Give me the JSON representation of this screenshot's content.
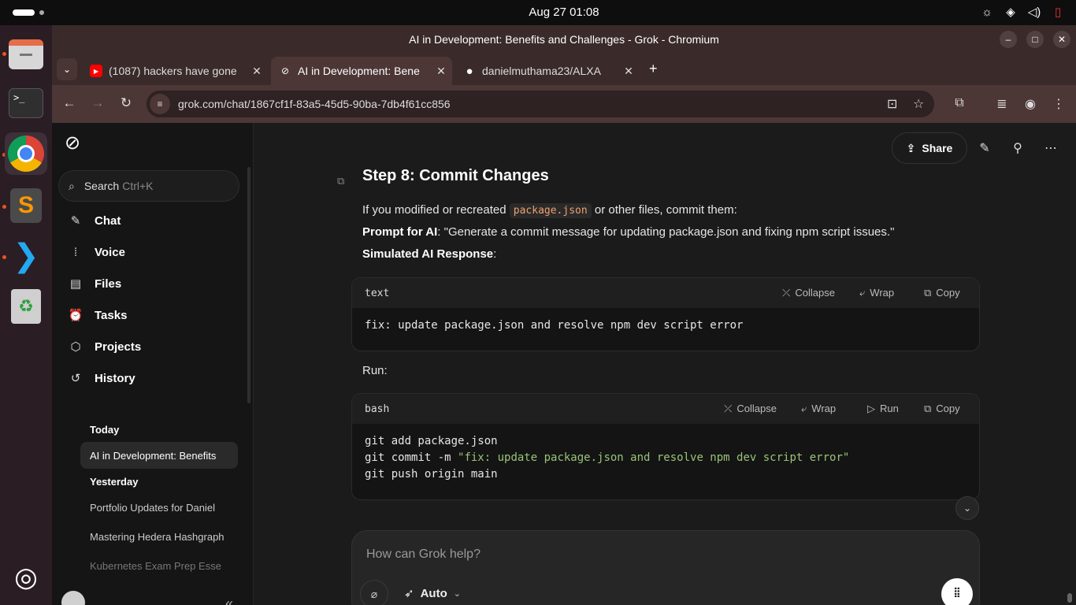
{
  "topbar": {
    "clock": "Aug 27  01:08",
    "tray_icons": [
      "brightness-icon",
      "wifi-icon",
      "volume-icon",
      "battery-icon"
    ]
  },
  "dock": {
    "apps": [
      "files",
      "terminal",
      "chromium",
      "sublime-text",
      "vscode",
      "trash",
      "ubuntu-apps"
    ]
  },
  "window": {
    "title": "AI in Development: Benefits and Challenges - Grok - Chromium"
  },
  "tabs": [
    {
      "label": "(1087) hackers have gone",
      "favicon": "youtube"
    },
    {
      "label": "AI in Development: Bene",
      "favicon": "grok",
      "active": true
    },
    {
      "label": "danielmuthama23/ALXA",
      "favicon": "github"
    }
  ],
  "omnibox": {
    "url": "grok.com/chat/1867cf1f-83a5-45d5-90ba-7db4f61cc856"
  },
  "sidebar": {
    "search_label": "Search",
    "search_shortcut": "Ctrl+K",
    "nav": [
      {
        "label": "Chat",
        "icon": "chat-icon"
      },
      {
        "label": "Voice",
        "icon": "voice-icon"
      },
      {
        "label": "Files",
        "icon": "files-icon"
      },
      {
        "label": "Tasks",
        "icon": "tasks-icon"
      },
      {
        "label": "Projects",
        "icon": "projects-icon"
      },
      {
        "label": "History",
        "icon": "history-icon"
      }
    ],
    "history": {
      "today_label": "Today",
      "today": [
        "AI in Development: Benefits"
      ],
      "yesterday_label": "Yesterday",
      "yesterday": [
        "Portfolio Updates for Daniel",
        "Mastering Hedera Hashgraph",
        "Kubernetes Exam Prep Esse"
      ]
    }
  },
  "header": {
    "share_label": "Share"
  },
  "content": {
    "heading": "Step 8: Commit Changes",
    "para1_before": "If you modified or recreated",
    "para1_code": "package.json",
    "para1_after": "or other files, commit them:",
    "prompt_label": "Prompt for AI",
    "prompt_text": ": \"Generate a commit message for updating package.json and fixing npm script issues.\"",
    "response_label": "Simulated AI Response",
    "response_colon": ":",
    "run_label": "Run:",
    "code1": {
      "lang": "text",
      "collapse": "Collapse",
      "wrap": "Wrap",
      "copy": "Copy",
      "line1": "fix: update package.json and resolve npm dev script error"
    },
    "code2": {
      "lang": "bash",
      "collapse": "Collapse",
      "wrap": "Wrap",
      "run": "Run",
      "copy": "Copy",
      "line1": "git add package.json",
      "line2_cmd": "git commit -m ",
      "line2_str": "\"fix: update package.json and resolve npm dev script error\"",
      "line3": "git push origin main"
    }
  },
  "composer": {
    "placeholder": "How can Grok help?",
    "mode": "Auto"
  }
}
